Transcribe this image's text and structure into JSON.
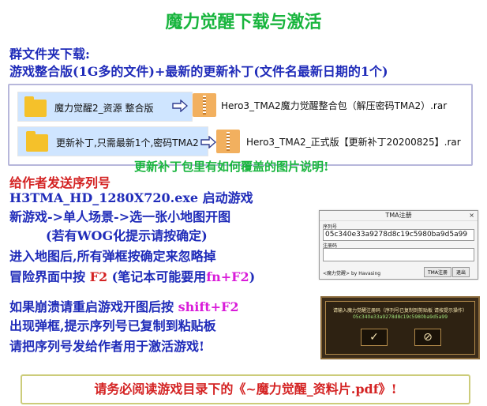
{
  "title": "魔力觉醒下载与激活",
  "group_files": {
    "heading": "群文件夹下载:",
    "subheading": "游戏整合版(1G多的文件)+最新的更新补丁(文件名最新日期的1个)"
  },
  "files": [
    {
      "folder_label": "魔力觉醒2_资源 整合版",
      "archive_name": "Hero3_TMA2魔力觉醒整合包（解压密码TMA2）.rar"
    },
    {
      "folder_label": "更新补丁,只需最新1个,密码TMA2",
      "archive_name": "Hero3_TMA2_正式版【更新补丁20200825】.rar"
    }
  ],
  "patch_note": "更新补丁包里有如何覆盖的图片说明!",
  "steps": {
    "line1": "给作者发送序列号",
    "line2": "H3TMA_HD_1280X720.exe 启动游戏",
    "line3": "新游戏->单人场景->选一张小地图开图",
    "line4": "(若有WOG化提示请按确定)",
    "line5": "进入地图后,所有弹框按确定来忽略掉",
    "line6_prefix": "冒险界面中按",
    "line6_key": "F2",
    "line6_mid": "(笔记本可能要用",
    "line6_key2": "fn+F2",
    "line6_suffix": ")"
  },
  "crash": {
    "line1_prefix": "如果崩溃请重启游戏开图后按",
    "line1_key": "shift+F2",
    "line2": "出现弹框,提示序列号已复制到粘贴板",
    "line3": "请把序列号发给作者用于激活游戏!"
  },
  "dialog": {
    "title": "TMA注册",
    "close": "×",
    "serial_label": "序列号",
    "serial_value": "05c340e33a9278d8c19c5980ba9d5a99",
    "regcode_label": "注册码",
    "footer": "<魔力觉醒> by Havasing",
    "register_button": "TMA注册",
    "exit_button": "退出"
  },
  "game_popup": {
    "text": "请输入魔力觉醒注册码（序列号已复制到剪贴板 请按提示操作）",
    "serial": "05c340e33a9278d8c19c5980ba9d5a99",
    "ok_button": "✓",
    "cancel_button": "⊘"
  },
  "notice": "请务必阅读游戏目录下的《~魔力觉醒_资料片.pdf》!",
  "colors": {
    "title_green": "#19b53e",
    "instruction_blue": "#1f2bb9",
    "highlight_red": "#d42323",
    "highlight_magenta": "#d91bd9",
    "row_highlight": "#cfe5ff",
    "folder_yellow": "#f5c12a",
    "archive_orange": "#f2b05f"
  }
}
